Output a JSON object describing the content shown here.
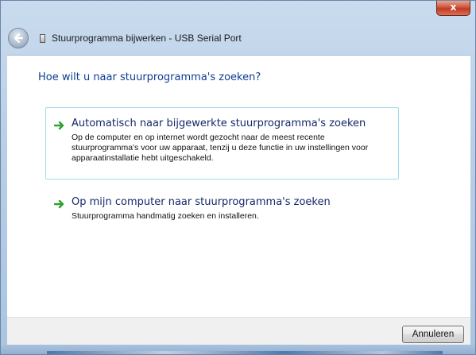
{
  "window": {
    "close_label": "x",
    "title": "Stuurprogramma bijwerken - USB Serial Port"
  },
  "wizard": {
    "question": "Hoe wilt u naar stuurprogramma's zoeken?",
    "options": [
      {
        "title": "Automatisch naar bijgewerkte stuurprogramma's zoeken",
        "description": "Op de computer en op internet wordt gezocht naar de meest recente stuurprogramma's voor uw apparaat, tenzij u deze functie in uw instellingen voor apparaatinstallatie hebt uitgeschakeld."
      },
      {
        "title": "Op mijn computer naar stuurprogramma's zoeken",
        "description": "Stuurprogramma handmatig zoeken en installeren."
      }
    ],
    "cancel_label": "Annuleren"
  },
  "colors": {
    "heading": "#0c3d91",
    "option_title": "#15286b",
    "arrow": "#2fa12f",
    "selection_border": "#9edbef"
  },
  "icons": {
    "back": "back-arrow-icon",
    "option": "green-arrow-icon",
    "wizard": "device-icon"
  }
}
